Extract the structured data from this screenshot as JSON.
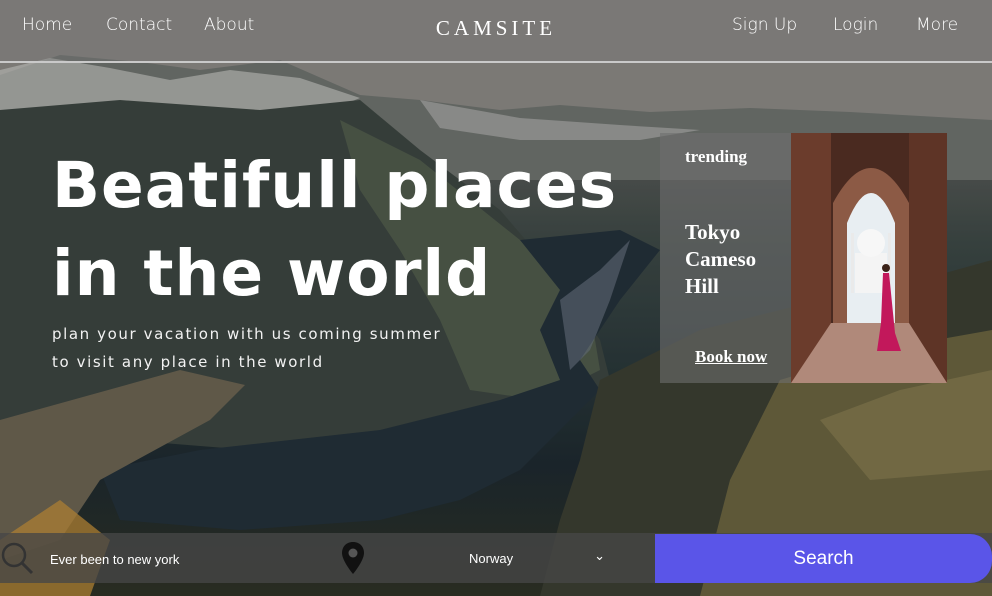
{
  "nav": {
    "left": [
      "Home",
      "Contact",
      "About"
    ],
    "brand": "CAMSITE",
    "right": [
      "Sign Up",
      "Login",
      "More"
    ]
  },
  "hero": {
    "title_line1": "Beatifull places",
    "title_line2": "in the world",
    "subtitle_line1": "plan your vacation with us coming summer",
    "subtitle_line2": "to visit any place in the world"
  },
  "trending": {
    "tag": "trending",
    "place": "Tokyo\nCameso\nHill",
    "cta": "Book now"
  },
  "search": {
    "placeholder": "Ever been to new york",
    "location_selected": "Norway",
    "button_label": "Search"
  },
  "colors": {
    "accent": "#5a55e8",
    "nav_border": "#c9c9c9"
  },
  "icons": {
    "search": "magnifier-icon",
    "location": "map-pin-icon",
    "dropdown": "chevron-down-icon"
  }
}
